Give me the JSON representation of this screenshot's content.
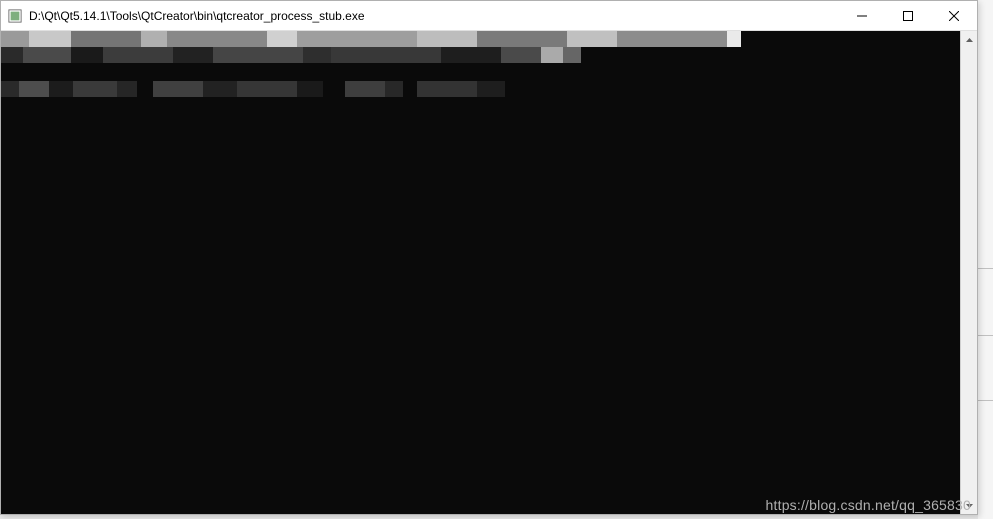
{
  "window": {
    "title": "D:\\Qt\\Qt5.14.1\\Tools\\QtCreator\\bin\\qtcreator_process_stub.exe"
  },
  "controls": {
    "minimize": "—",
    "maximize": "☐",
    "close": "✕"
  },
  "scrollbar": {
    "up": "▲",
    "down": "▼"
  },
  "watermark": "https://blog.csdn.net/qq_365830",
  "console": {
    "content_redacted": true
  }
}
